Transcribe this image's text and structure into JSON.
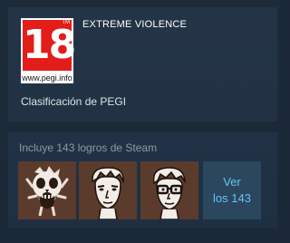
{
  "rating": {
    "logo_number": "18",
    "logo_url": "www.pegi.info",
    "logo_tm": "TM",
    "descriptor": "EXTREME VIOLENCE",
    "caption": "Clasificación de PEGI"
  },
  "achievements": {
    "heading": "Incluye 143 logros de Steam",
    "icons": [
      {
        "icon": "screaming-skull-icon"
      },
      {
        "icon": "face-portrait-icon"
      },
      {
        "icon": "glasses-face-portrait-icon"
      }
    ],
    "view_all": {
      "line1": "Ver",
      "line2": "los 143"
    }
  },
  "colors": {
    "background": "#1b2838",
    "pegi_red": "#e31d1a",
    "link_blue": "#67c1f5",
    "icon_bg": "#5a3a2a"
  }
}
